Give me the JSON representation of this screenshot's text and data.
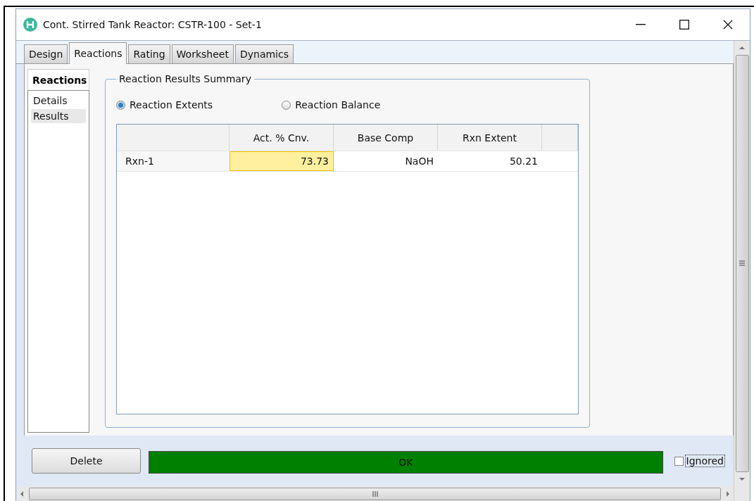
{
  "window": {
    "title": "Cont. Stirred Tank Reactor: CSTR-100 - Set-1"
  },
  "tabs": [
    {
      "label": "Design",
      "selected": false
    },
    {
      "label": "Reactions",
      "selected": true
    },
    {
      "label": "Rating",
      "selected": false
    },
    {
      "label": "Worksheet",
      "selected": false
    },
    {
      "label": "Dynamics",
      "selected": false
    }
  ],
  "sidebar": {
    "header": "Reactions",
    "items": [
      {
        "label": "Details",
        "selected": false
      },
      {
        "label": "Results",
        "selected": true
      }
    ]
  },
  "group": {
    "title": "Reaction Results Summary",
    "radios": [
      {
        "label": "Reaction Extents",
        "selected": true
      },
      {
        "label": "Reaction Balance",
        "selected": false
      }
    ],
    "table": {
      "columns": [
        {
          "label": "Act. % Cnv."
        },
        {
          "label": "Base Comp"
        },
        {
          "label": "Rxn Extent"
        }
      ],
      "rows": [
        {
          "name": "Rxn-1",
          "cells": [
            {
              "value": "73.73",
              "selected": true
            },
            {
              "value": "NaOH",
              "selected": false
            },
            {
              "value": "50.21",
              "selected": false
            }
          ]
        }
      ]
    }
  },
  "footer": {
    "delete_button": "Delete",
    "status": "OK",
    "ignored": {
      "label": "Ignored",
      "checked": false
    }
  }
}
